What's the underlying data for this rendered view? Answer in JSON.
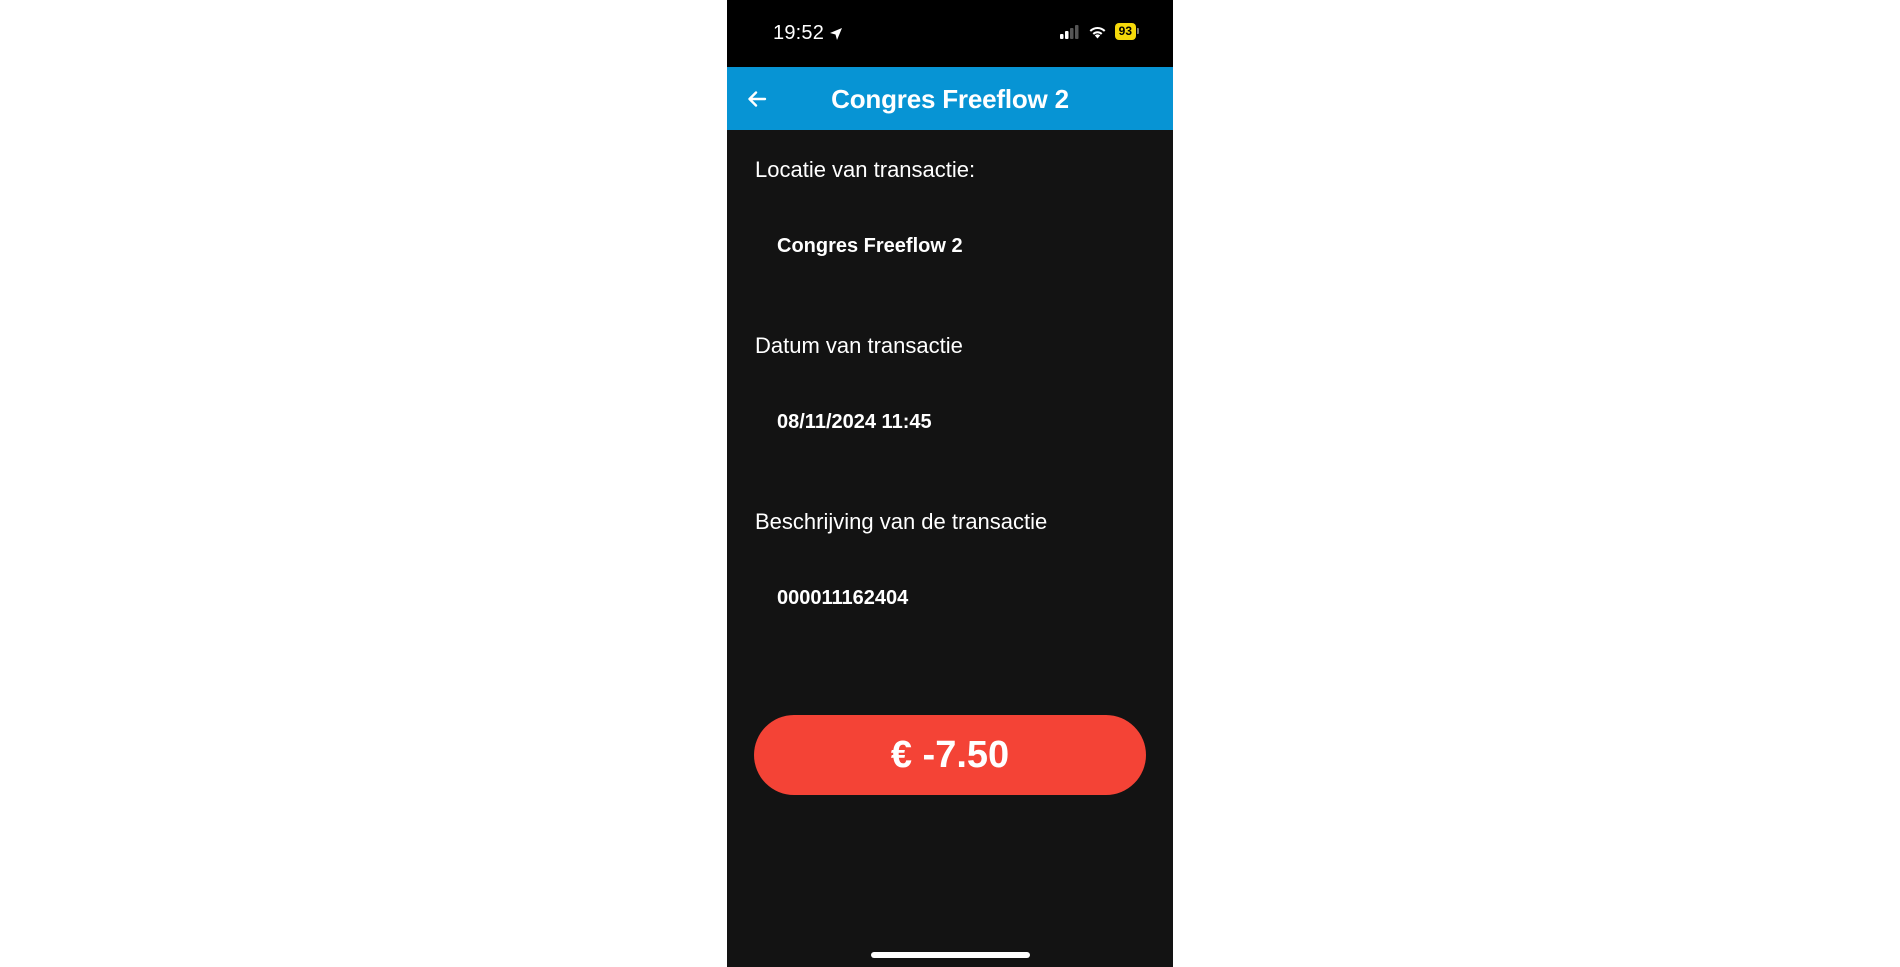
{
  "status_bar": {
    "time": "19:52",
    "battery": "93"
  },
  "app_bar": {
    "title": "Congres Freeflow 2"
  },
  "details": {
    "location_label": "Locatie van transactie:",
    "location_value": "Congres Freeflow 2",
    "date_label": "Datum van transactie",
    "date_value": "08/11/2024 11:45",
    "description_label": "Beschrijving van de transactie",
    "description_value": "000011162404"
  },
  "amount": {
    "text": "€ -7.50",
    "color": "#f44336"
  },
  "colors": {
    "app_bar": "#0794d4",
    "background": "#131313",
    "battery": "#f5d90a"
  },
  "icons": {
    "back": "arrow-left-icon",
    "location_arrow": "location-arrow-icon",
    "signal": "cellular-signal-icon",
    "wifi": "wifi-icon",
    "battery": "battery-icon"
  }
}
